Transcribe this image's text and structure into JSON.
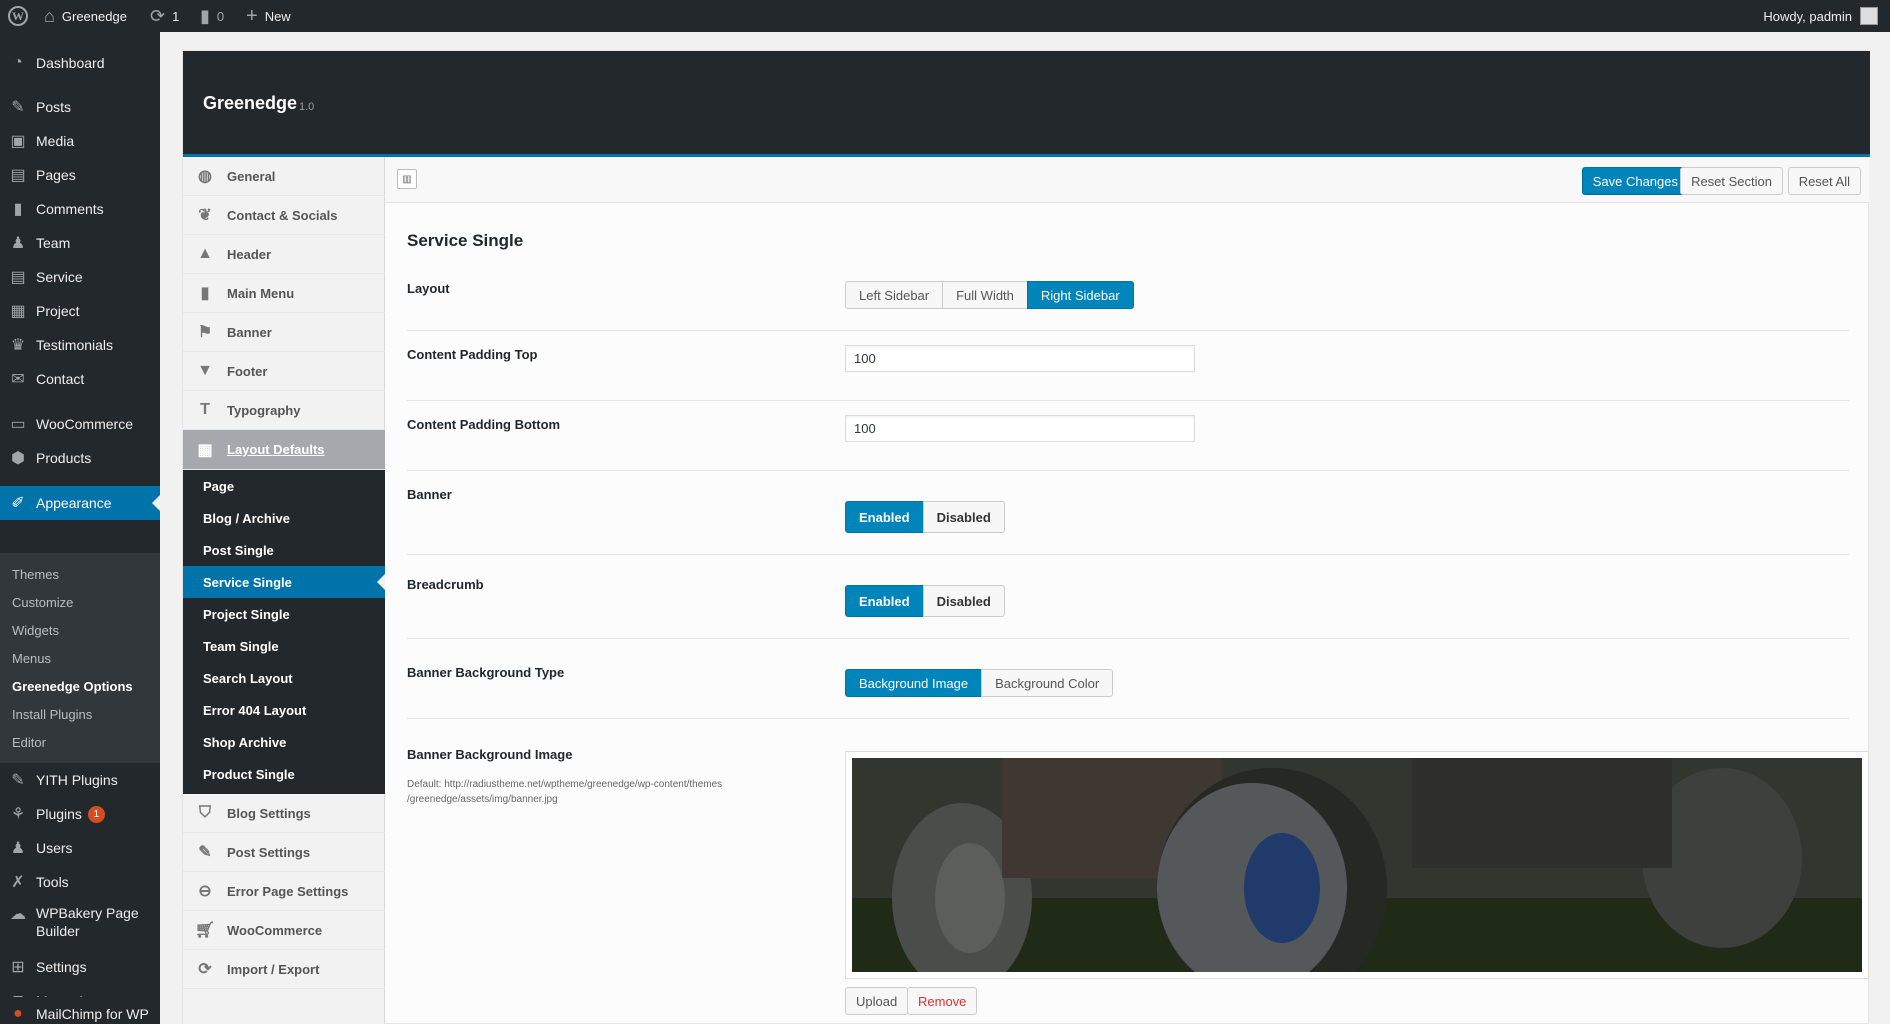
{
  "adminbar": {
    "site_name": "Greenedge",
    "updates_count": "1",
    "comments_count": "0",
    "new_label": "New",
    "howdy": "Howdy, padmin"
  },
  "admin_menu": {
    "items": [
      {
        "label": "Dashboard",
        "icon": "dashboard-icon"
      },
      {
        "label": "Posts",
        "icon": "pushpin-icon"
      },
      {
        "label": "Media",
        "icon": "media-icon"
      },
      {
        "label": "Pages",
        "icon": "pages-icon"
      },
      {
        "label": "Comments",
        "icon": "comments-icon"
      },
      {
        "label": "Team",
        "icon": "team-icon"
      },
      {
        "label": "Service",
        "icon": "service-icon"
      },
      {
        "label": "Project",
        "icon": "project-icon"
      },
      {
        "label": "Testimonials",
        "icon": "testimonials-icon"
      },
      {
        "label": "Contact",
        "icon": "contact-icon"
      },
      {
        "label": "WooCommerce",
        "icon": "woocommerce-icon"
      },
      {
        "label": "Products",
        "icon": "products-icon"
      },
      {
        "label": "Appearance",
        "icon": "appearance-icon"
      },
      {
        "label": "YITH Plugins",
        "icon": "yith-icon"
      },
      {
        "label": "Plugins",
        "icon": "plugins-icon",
        "badge": "1"
      },
      {
        "label": "Users",
        "icon": "users-icon"
      },
      {
        "label": "Tools",
        "icon": "tools-icon"
      },
      {
        "label": "WPBakery Page",
        "label2": "Builder",
        "icon": "wpbakery-icon"
      },
      {
        "label": "Settings",
        "icon": "settings-icon"
      },
      {
        "label": "Meow Apps",
        "icon": "meow-icon"
      },
      {
        "label": "MailChimp for WP",
        "icon": "mailchimp-icon"
      }
    ],
    "appearance_submenu": [
      "Themes",
      "Customize",
      "Widgets",
      "Menus",
      "Greenedge Options",
      "Install Plugins",
      "Editor"
    ]
  },
  "panel": {
    "title": "Greenedge",
    "version": "1.0"
  },
  "redux_sidebar": {
    "sections": [
      {
        "label": "General",
        "icon": "globe-icon"
      },
      {
        "label": "Contact & Socials",
        "icon": "twitter-icon"
      },
      {
        "label": "Header",
        "icon": "triangle-up-icon"
      },
      {
        "label": "Main Menu",
        "icon": "book-icon"
      },
      {
        "label": "Banner",
        "icon": "flag-icon"
      },
      {
        "label": "Footer",
        "icon": "triangle-down-icon"
      },
      {
        "label": "Typography",
        "icon": "text-icon"
      },
      {
        "label": "Layout Defaults",
        "icon": "grid-icon"
      }
    ],
    "layout_subsections": [
      "Page",
      "Blog / Archive",
      "Post Single",
      "Service Single",
      "Project Single",
      "Team Single",
      "Search Layout",
      "Error 404 Layout",
      "Shop Archive",
      "Product Single"
    ],
    "sections_after": [
      {
        "label": "Blog Settings",
        "icon": "tags-icon"
      },
      {
        "label": "Post Settings",
        "icon": "edit-icon"
      },
      {
        "label": "Error Page Settings",
        "icon": "minus-circle-icon"
      },
      {
        "label": "WooCommerce",
        "icon": "cart-icon"
      },
      {
        "label": "Import / Export",
        "icon": "refresh-icon"
      }
    ]
  },
  "toolbar": {
    "save": "Save Changes",
    "reset_section": "Reset Section",
    "reset_all": "Reset All"
  },
  "main": {
    "section_title": "Service Single",
    "layout": {
      "label": "Layout",
      "options": [
        "Left Sidebar",
        "Full Width",
        "Right Sidebar"
      ],
      "selected": "Right Sidebar"
    },
    "padding_top": {
      "label": "Content Padding Top",
      "value": "100"
    },
    "padding_bottom": {
      "label": "Content Padding Bottom",
      "value": "100"
    },
    "banner": {
      "label": "Banner",
      "options": [
        "Enabled",
        "Disabled"
      ],
      "selected": "Enabled"
    },
    "breadcrumb": {
      "label": "Breadcrumb",
      "options": [
        "Enabled",
        "Disabled"
      ],
      "selected": "Enabled"
    },
    "banner_bg_type": {
      "label": "Banner Background Type",
      "options": [
        "Background Image",
        "Background Color"
      ],
      "selected": "Background Image"
    },
    "banner_bg_image": {
      "label": "Banner Background Image",
      "description": "Default: http://radiustheme.net/wptheme/greenedge/wp-content/themes /greenedge/assets/img/banner.jpg",
      "upload": "Upload",
      "remove": "Remove"
    }
  },
  "colors": {
    "accent": "#0085ba",
    "admin_dark": "#23282d",
    "remove_red": "#dd3333"
  }
}
